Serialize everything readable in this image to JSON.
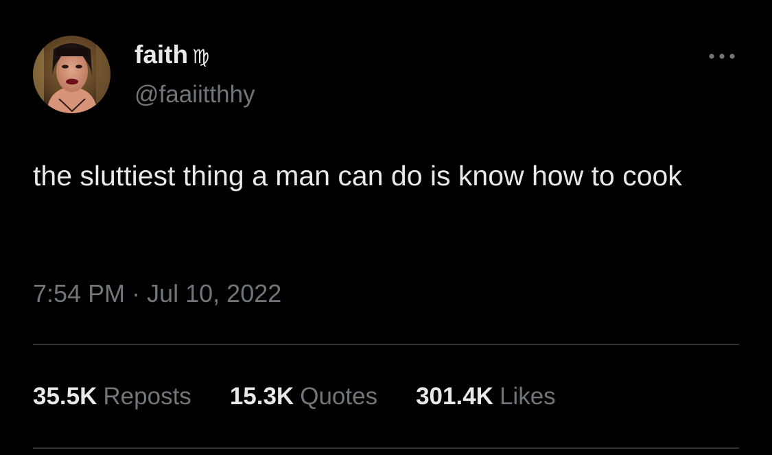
{
  "tweet": {
    "author": {
      "display_name": "faith",
      "zodiac_glyph": "♍",
      "handle": "@faaiitthhy"
    },
    "text": "the sluttiest thing a man can do is know how to cook",
    "timestamp": {
      "time": "7:54 PM",
      "separator": "·",
      "date": "Jul 10, 2022"
    },
    "stats": [
      {
        "value": "35.5K",
        "label": "Reposts"
      },
      {
        "value": "15.3K",
        "label": "Quotes"
      },
      {
        "value": "301.4K",
        "label": "Likes"
      }
    ]
  },
  "icons": {
    "more": "more-horizontal-icon"
  },
  "colors": {
    "background": "#000000",
    "primary_text": "#e7e9ea",
    "secondary_text": "#71767b",
    "divider": "#2f3336"
  }
}
